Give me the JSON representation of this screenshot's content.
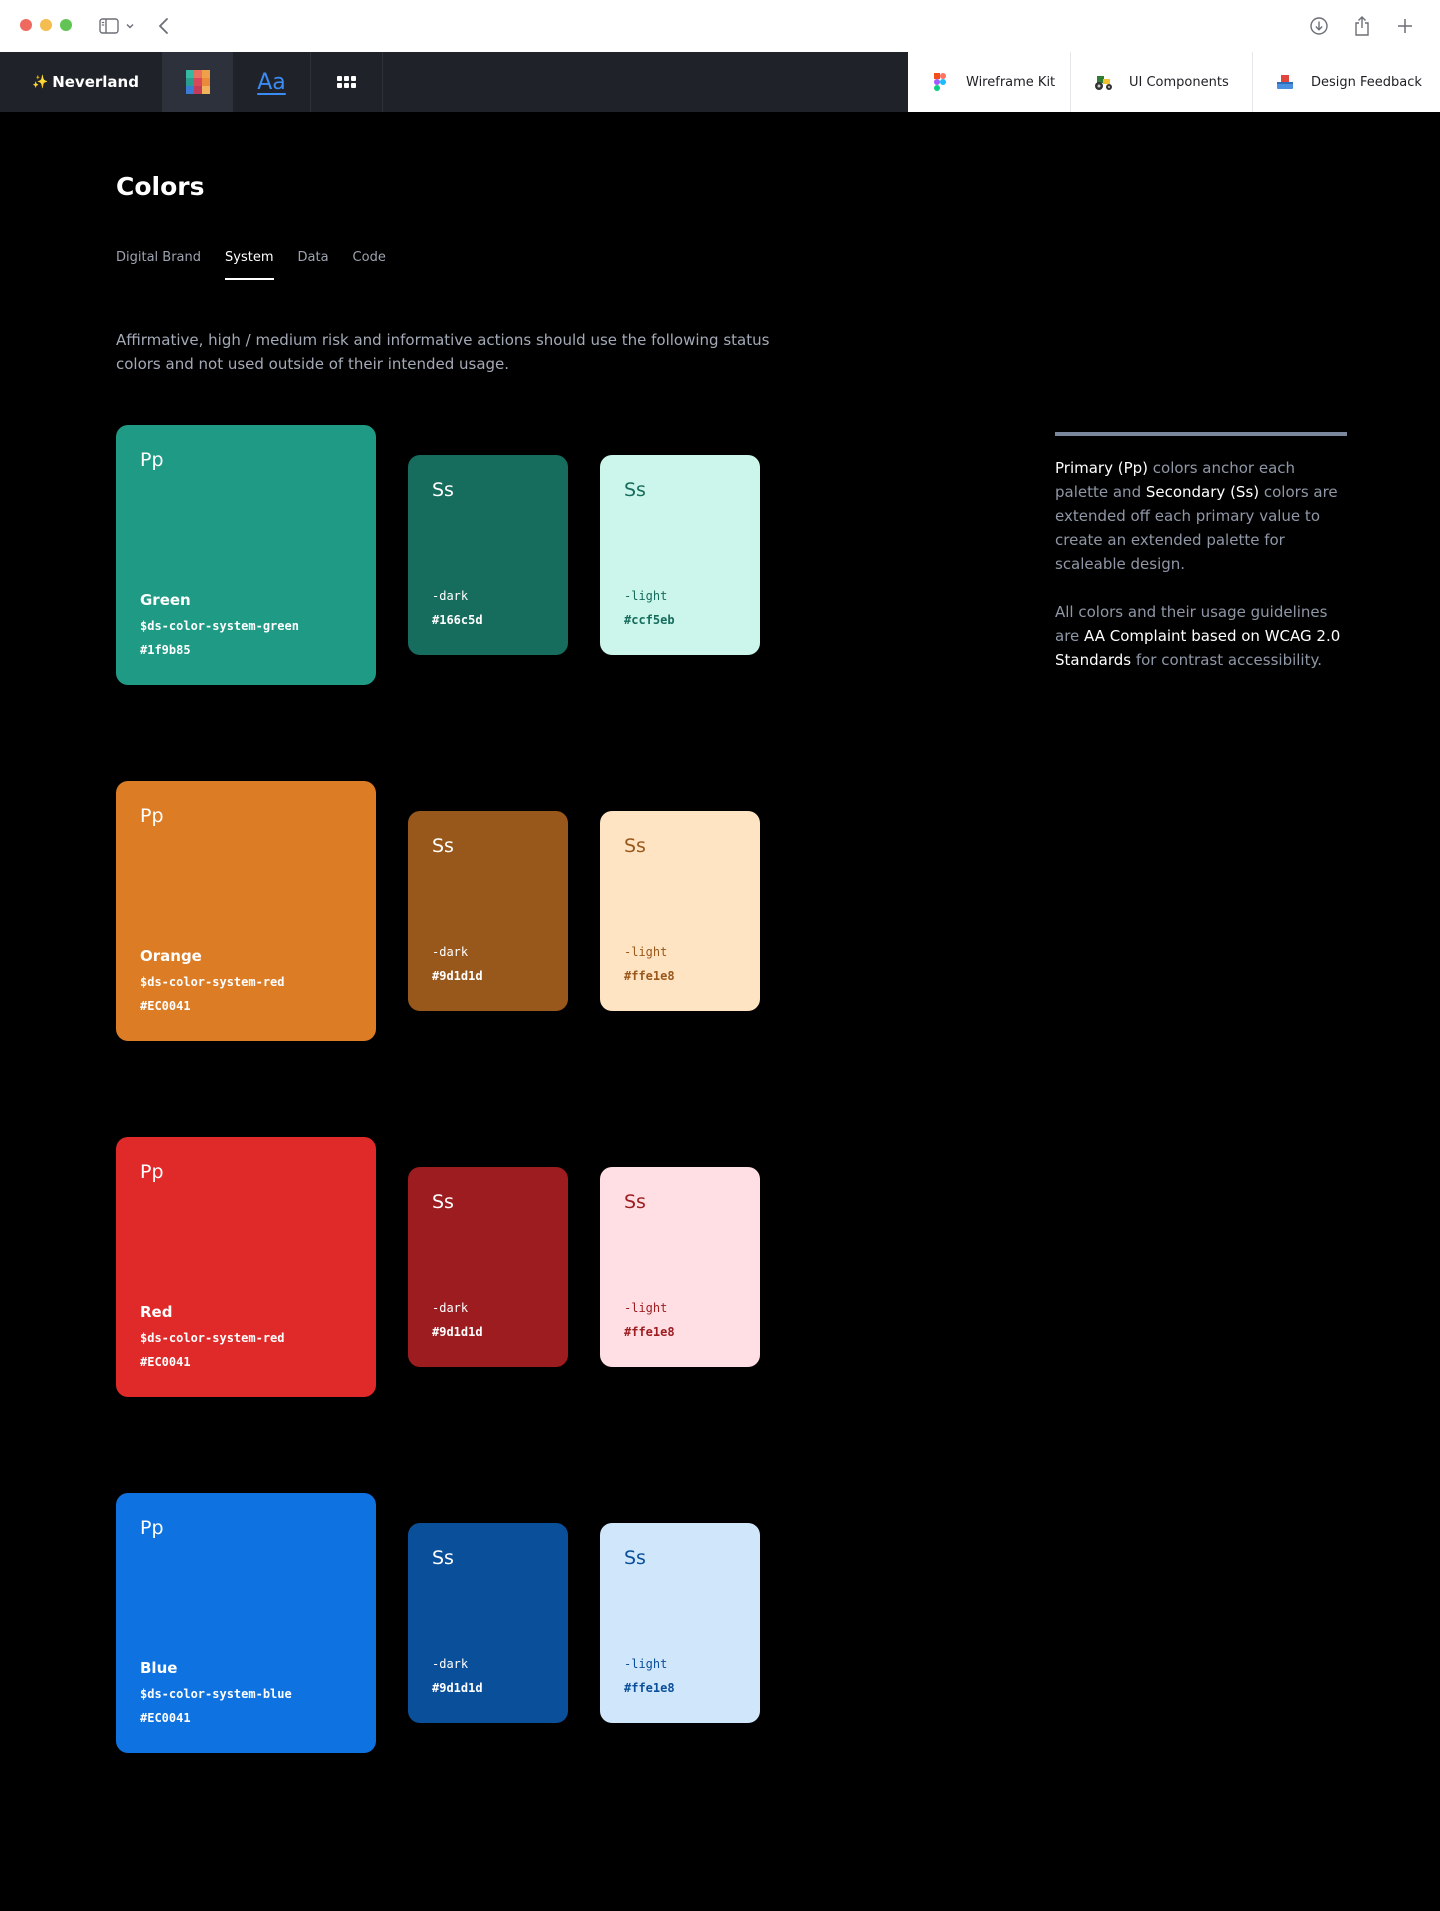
{
  "colors": {
    "green": "#1f9b85",
    "green_dark": "#166c5d",
    "green_light": "#ccf5eb",
    "orange": "#dc7c25",
    "orange_dark": "#99581b",
    "orange_light": "#ffe4c4",
    "red": "#e02a2a",
    "red_dark": "#9c1c1f",
    "red_light": "#ffdfe4",
    "blue": "#0e72e0",
    "blue_dark": "#0a4f9a",
    "blue_light": "#d0e6fb"
  },
  "topbar": {
    "brand": "Neverland",
    "brand_icon": "sparkle-icon",
    "tools": [
      "palette-icon",
      "typography-icon",
      "grid-icon"
    ],
    "typography_label": "Aa",
    "links": [
      {
        "label": "Wireframe Kit",
        "icon": "figma-icon"
      },
      {
        "label": "UI Components",
        "icon": "tractor-icon"
      },
      {
        "label": "Design Feedback",
        "icon": "inbox-icon"
      }
    ]
  },
  "page": {
    "title": "Colors",
    "tabs": [
      "Digital Brand",
      "System",
      "Data",
      "Code"
    ],
    "active_tab": "System",
    "intro": "Affirmative, high / medium risk and informative actions should use the following status colors and not used outside of their intended usage."
  },
  "sidenote": {
    "p1_primary": "Primary (Pp)",
    "p1_a": " colors anchor each palette and ",
    "p1_secondary": "Secondary (Ss)",
    "p1_b": " colors are extended off each primary value to create an extended palette for scaleable design.",
    "p2_a": "All colors and their usage guidelines are ",
    "p2_b": "AA Complaint based on WCAG 2.0 Standards",
    "p2_c": " for contrast accessibility."
  },
  "palettes": [
    {
      "pp": "Pp",
      "name": "Green",
      "var": "$ds-color-system-green",
      "hex": "#1f9b85",
      "dark": {
        "ss": "Ss",
        "label": "-dark",
        "hex": "#166c5d"
      },
      "light": {
        "ss": "Ss",
        "label": "-light",
        "hex": "#ccf5eb"
      }
    },
    {
      "pp": "Pp",
      "name": "Orange",
      "var": "$ds-color-system-red",
      "hex": "#EC0041",
      "dark": {
        "ss": "Ss",
        "label": "-dark",
        "hex": "#9d1d1d"
      },
      "light": {
        "ss": "Ss",
        "label": "-light",
        "hex": "#ffe1e8"
      }
    },
    {
      "pp": "Pp",
      "name": "Red",
      "var": "$ds-color-system-red",
      "hex": "#EC0041",
      "dark": {
        "ss": "Ss",
        "label": "-dark",
        "hex": "#9d1d1d"
      },
      "light": {
        "ss": "Ss",
        "label": "-light",
        "hex": "#ffe1e8"
      }
    },
    {
      "pp": "Pp",
      "name": "Blue",
      "var": "$ds-color-system-blue",
      "hex": "#EC0041",
      "dark": {
        "ss": "Ss",
        "label": "-dark",
        "hex": "#9d1d1d"
      },
      "light": {
        "ss": "Ss",
        "label": "-light",
        "hex": "#ffe1e8"
      }
    }
  ]
}
